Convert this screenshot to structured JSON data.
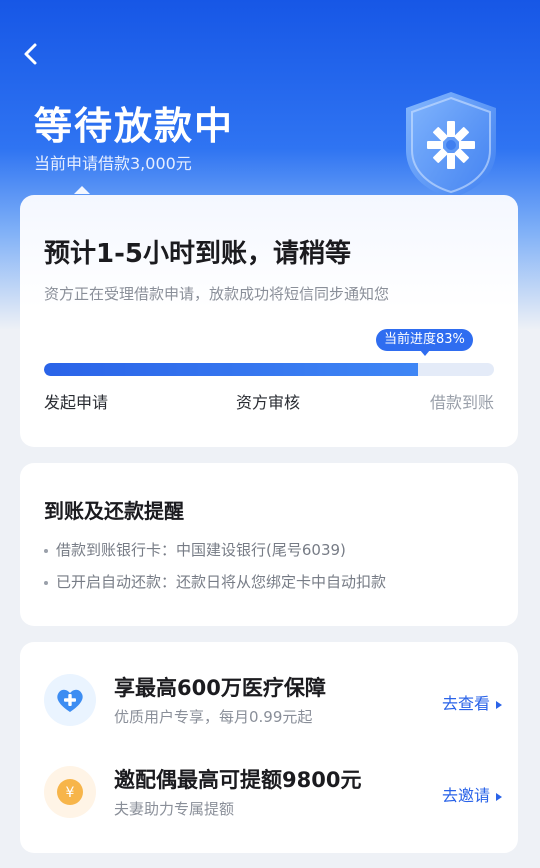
{
  "header": {
    "title": "等待放款中",
    "subtitle": "当前申请借款3,000元"
  },
  "status_card": {
    "title": "预计1-5小时到账，请稍等",
    "description": "资方正在受理借款申请，放款成功将短信同步通知您",
    "progress_label": "当前进度83%",
    "progress_value": 0.83,
    "steps": [
      "发起申请",
      "资方审核",
      "借款到账"
    ]
  },
  "reminder_card": {
    "title": "到账及还款提醒",
    "items": [
      "借款到账银行卡：中国建设银行(尾号6039)",
      "已开启自动还款：还款日将从您绑定卡中自动扣款"
    ]
  },
  "promos": [
    {
      "icon": "heart-plus-icon",
      "title": "享最高600万医疗保障",
      "subtitle": "优质用户专享，每月0.99元起",
      "link": "去查看"
    },
    {
      "icon": "yen-coin-icon",
      "title": "邀配偶最高可提额9800元",
      "subtitle": "夫妻助力专属提额",
      "link": "去邀请"
    }
  ],
  "colors": {
    "accent": "#2a63e8",
    "hero_top": "#1757e6",
    "background": "#eef1f6"
  }
}
